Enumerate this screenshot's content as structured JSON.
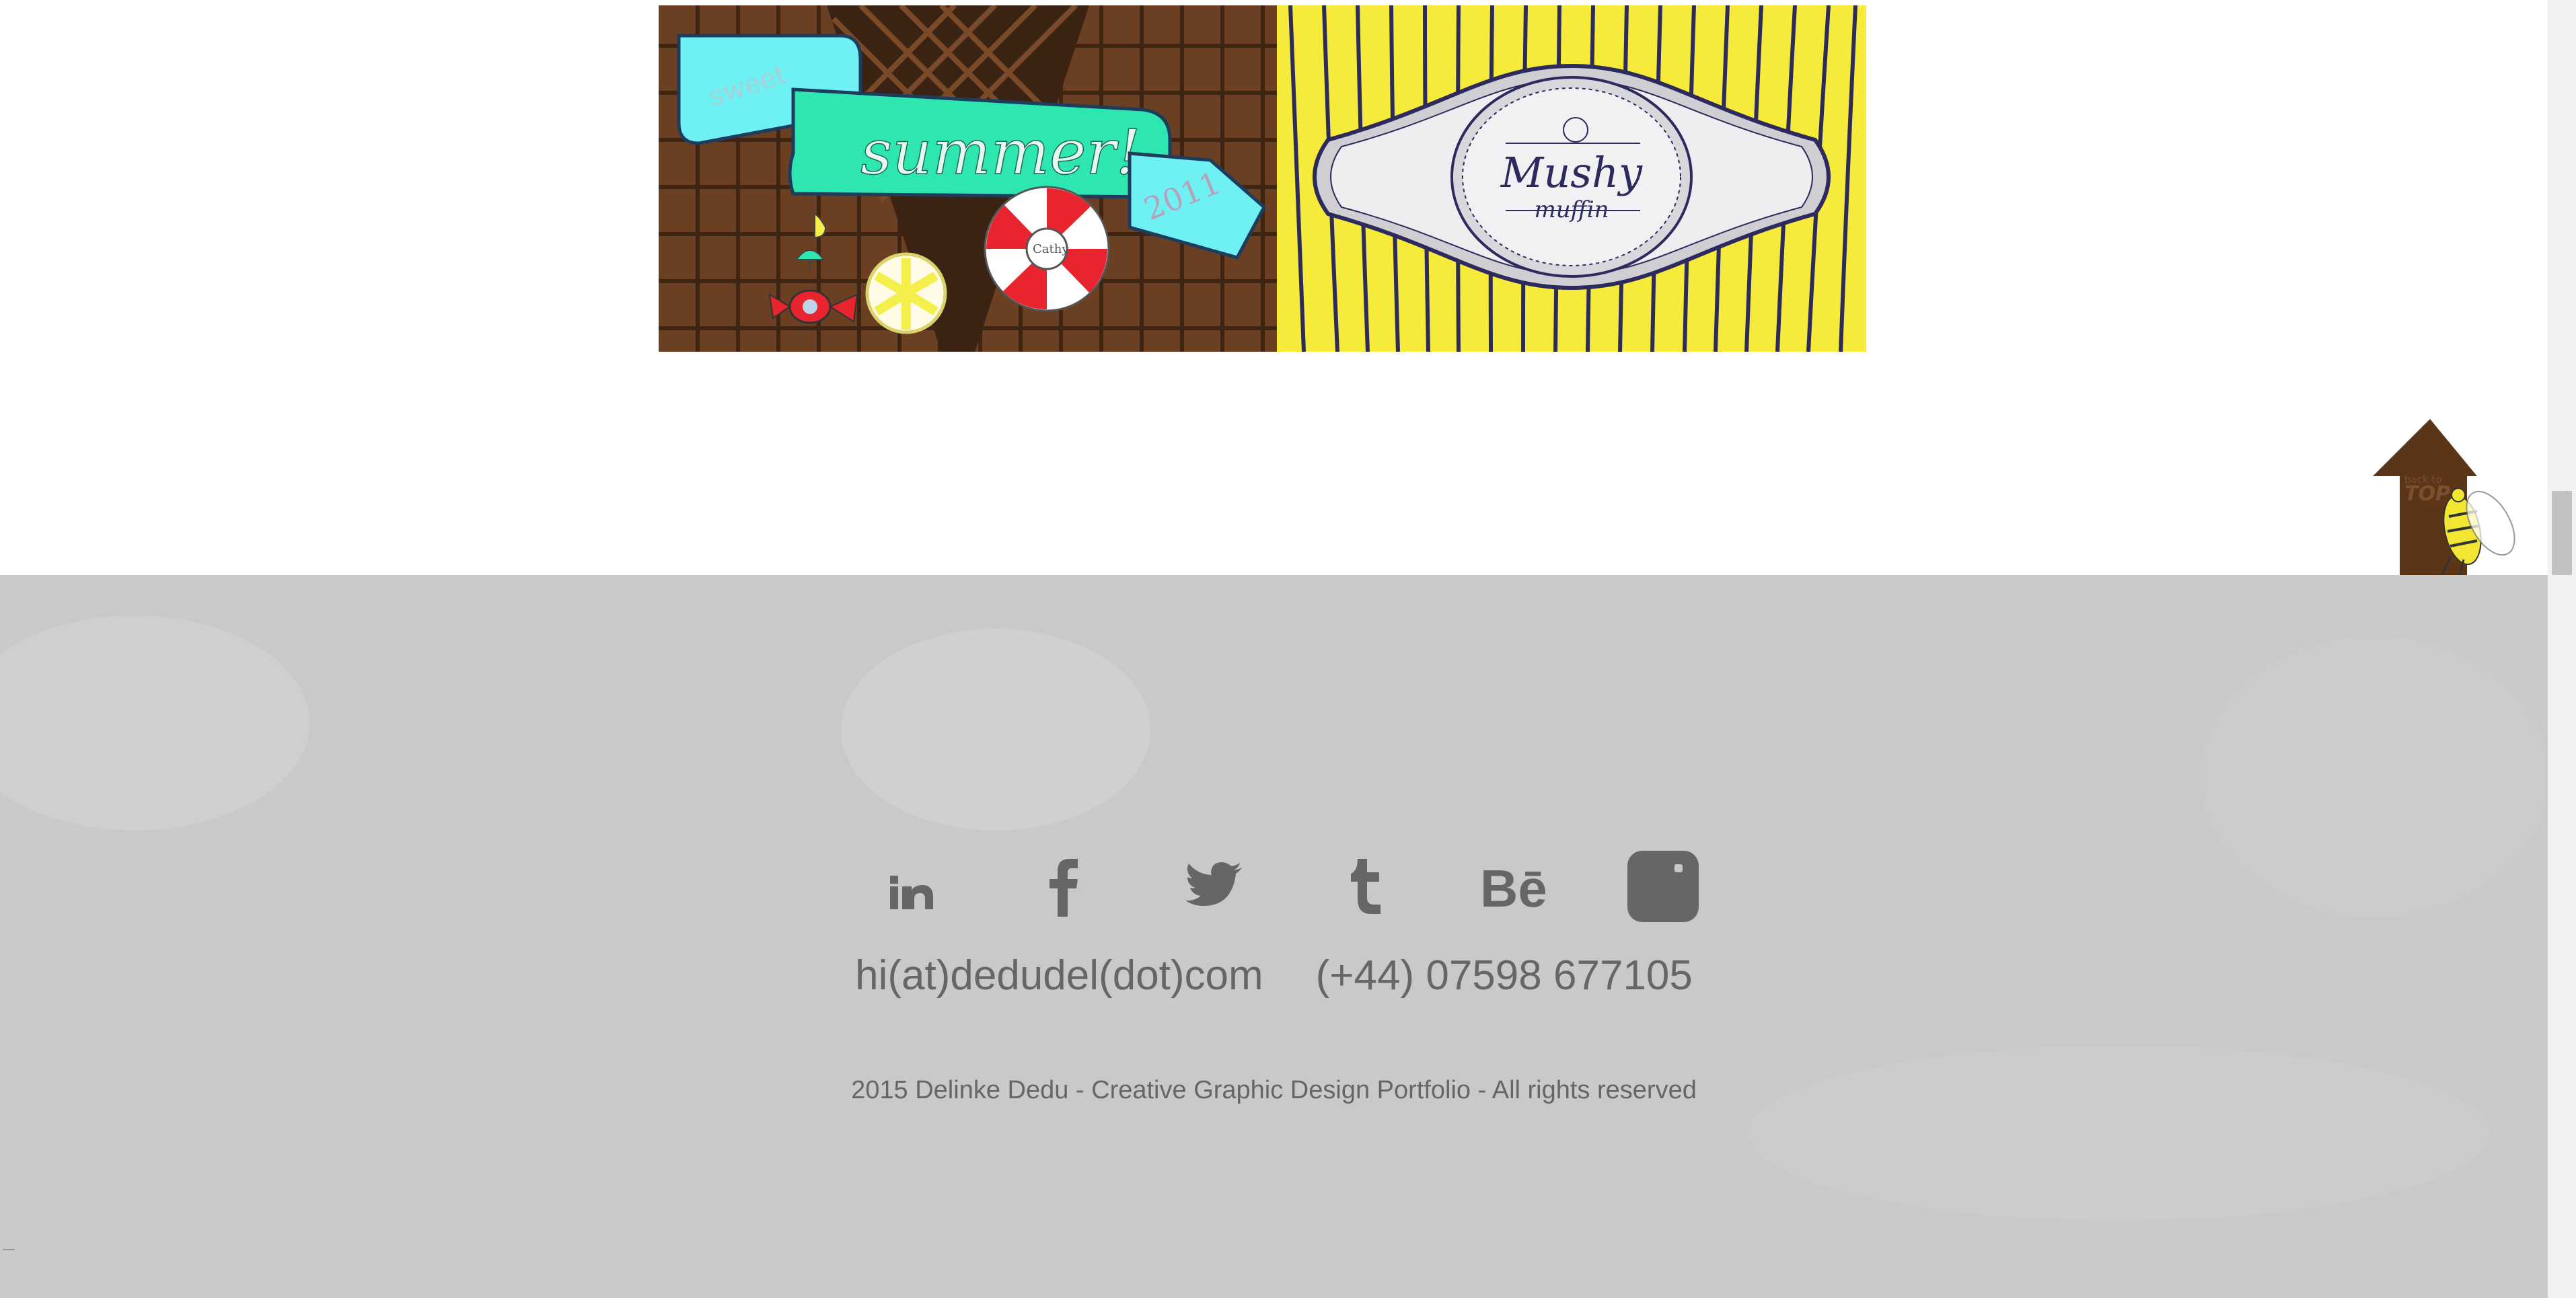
{
  "portfolio": {
    "tile_summer": {
      "ribbon_text": "summer!",
      "ribbon_left_text": "sweet",
      "ribbon_year": "2011",
      "candy_label": "Cathy",
      "colors": {
        "chocolate": "#6b3f22",
        "ribbon": "#2ee6b0",
        "ribbon_light": "#6ff0f2",
        "candy_red": "#e8242e",
        "lemon": "#f4ef4a"
      }
    },
    "tile_muffin": {
      "brand_line1": "Mushy",
      "brand_line2": "muffin",
      "colors": {
        "background": "#f6ea3a",
        "stripes": "#2d2a5e",
        "label": "#e8e8ea"
      }
    }
  },
  "back_to_top": {
    "label_line1": "back to",
    "label_line2": "TOP",
    "colors": {
      "arrow": "#5b3515",
      "bee": "#f2e633"
    }
  },
  "footer": {
    "social": [
      {
        "name": "linkedin",
        "icon": "linkedin-icon",
        "glyph": "in"
      },
      {
        "name": "facebook",
        "icon": "facebook-icon",
        "glyph": "f"
      },
      {
        "name": "twitter",
        "icon": "twitter-icon",
        "glyph": "bird"
      },
      {
        "name": "tumblr",
        "icon": "tumblr-icon",
        "glyph": "t"
      },
      {
        "name": "behance",
        "icon": "behance-icon",
        "glyph": "Bē"
      },
      {
        "name": "instagram",
        "icon": "instagram-icon",
        "glyph": "square"
      }
    ],
    "email": "hi(at)dedudel(dot)com",
    "phone": "(+44) 07598 677105",
    "copyright": "2015 Delinke Dedu - Creative Graphic Design Portfolio - All rights reserved",
    "colors": {
      "background": "#c9c9c9",
      "text": "#666666"
    }
  }
}
